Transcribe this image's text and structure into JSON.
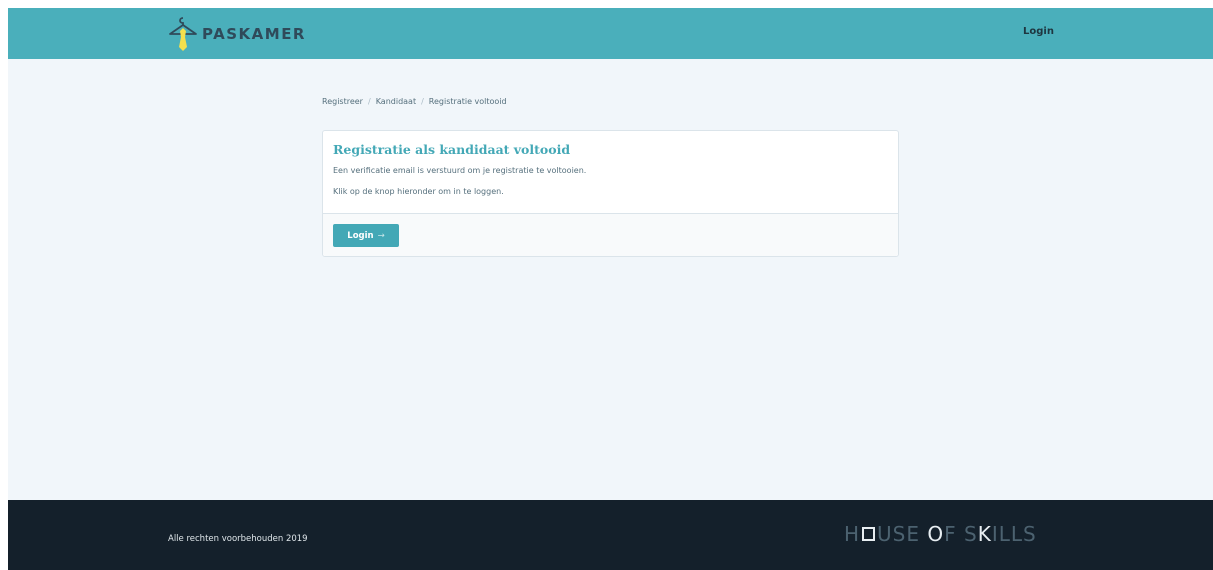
{
  "header": {
    "brand": "PASKAMER",
    "login_label": "Login"
  },
  "breadcrumb": {
    "items": [
      "Registreer",
      "Kandidaat",
      "Registratie voltooid"
    ],
    "separator": "/"
  },
  "card": {
    "title": "Registratie als kandidaat voltooid",
    "line1": "Een verificatie email is verstuurd om je registratie te voltooien.",
    "line2": "Klik op de knop hieronder om in te loggen.",
    "button_label": "Login",
    "button_arrow": "→"
  },
  "footer": {
    "copyright": "Alle rechten voorbehouden 2019",
    "partner_logo": {
      "h": "H",
      "use": "USE",
      "o": "O",
      "f": "F",
      "s": "S",
      "k": "K",
      "ills": "ILLS"
    }
  },
  "colors": {
    "header_bg": "#4aafbb",
    "page_bg": "#f1f6fa",
    "accent": "#43a8b6",
    "footer_bg": "#14202b",
    "logo_tie": "#f4e04d"
  },
  "icons": {
    "logo": "hanger-tie-icon",
    "button_arrow": "arrow-right-icon"
  }
}
